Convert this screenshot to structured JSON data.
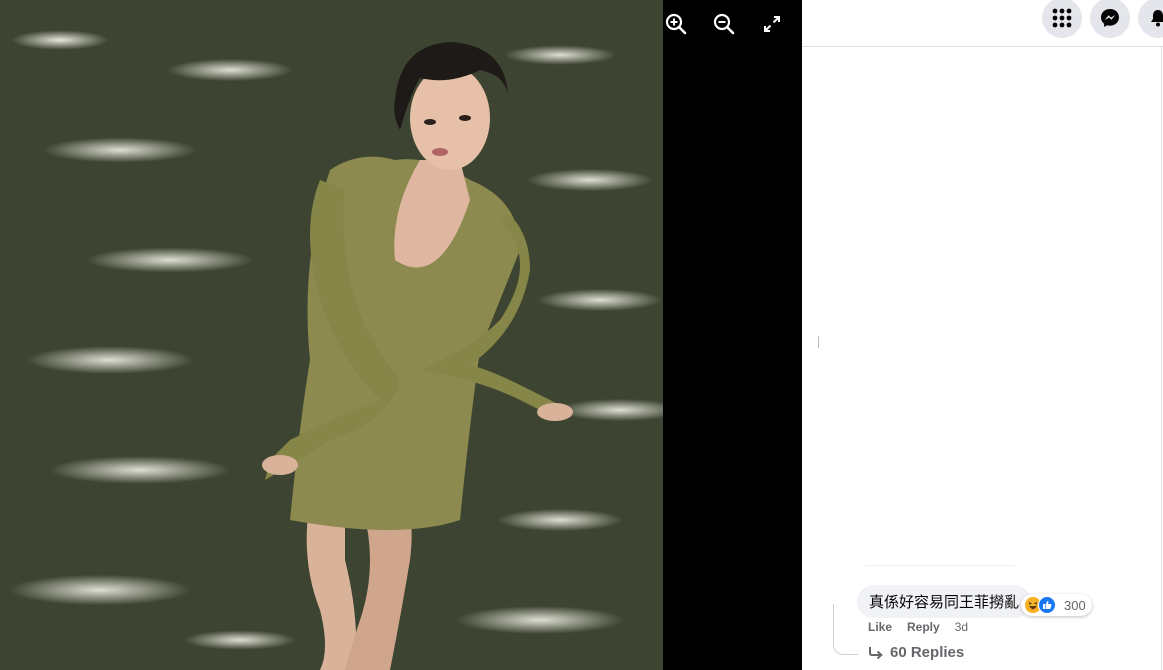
{
  "viewer": {
    "tools": [
      {
        "icon": "zoom-in-icon"
      },
      {
        "icon": "zoom-out-icon"
      },
      {
        "icon": "fullscreen-icon"
      }
    ]
  },
  "topbar": {
    "buttons": [
      {
        "icon": "menu-grid-icon"
      },
      {
        "icon": "messenger-icon"
      },
      {
        "icon": "notifications-bell-icon"
      }
    ]
  },
  "comment": {
    "text": "真係好容易同王菲撈亂",
    "reaction_icons": [
      "haha-icon",
      "like-icon"
    ],
    "reaction_count": "300",
    "actions": {
      "like": "Like",
      "reply": "Reply",
      "time": "3d"
    },
    "replies": "60 Replies"
  },
  "colors": {
    "accent": "#1877f2",
    "secondary_text": "#65676b",
    "bubble": "#f0f2f5",
    "haha": "#f7b125"
  }
}
